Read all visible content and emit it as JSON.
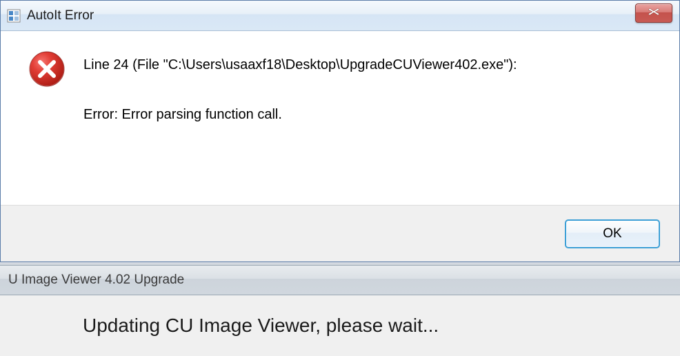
{
  "error_dialog": {
    "title": "AutoIt Error",
    "message_line1": "Line 24  (File \"C:\\Users\\usaaxf18\\Desktop\\UpgradeCUViewer402.exe\"):",
    "message_line2": "Error: Error parsing function call.",
    "ok_label": "OK"
  },
  "background_window": {
    "title": "U Image Viewer 4.02 Upgrade",
    "message": "Updating CU Image Viewer, please wait..."
  }
}
